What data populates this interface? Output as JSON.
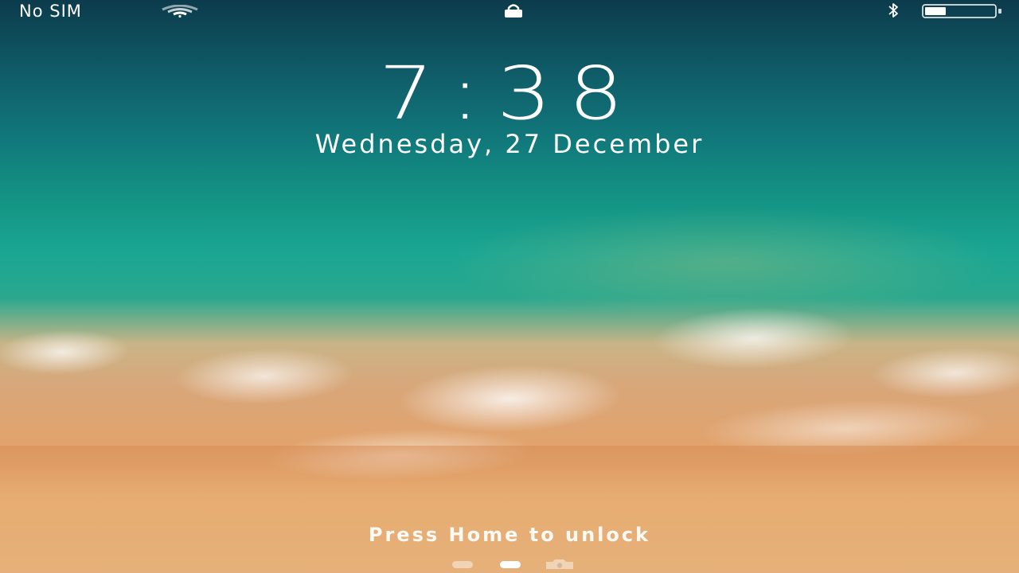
{
  "status_bar": {
    "carrier": "No SIM",
    "wifi_icon": "wifi-icon",
    "lock_icon": "lock-icon",
    "bluetooth_icon": "bluetooth-icon",
    "battery_icon": "battery-icon",
    "battery_level": 0.3
  },
  "lock_screen": {
    "time": "7:38",
    "date": "Wednesday, 27 December",
    "unlock_hint": "Press Home to unlock"
  },
  "pager": {
    "pages": [
      "widgets",
      "lock-screen",
      "camera"
    ],
    "active_index": 1,
    "camera_icon": "camera-icon"
  },
  "colors": {
    "text": "#ffffff",
    "sea_deep": "#0c3b4c",
    "sea_turquoise": "#1aa693",
    "sand": "#e2a36c"
  }
}
